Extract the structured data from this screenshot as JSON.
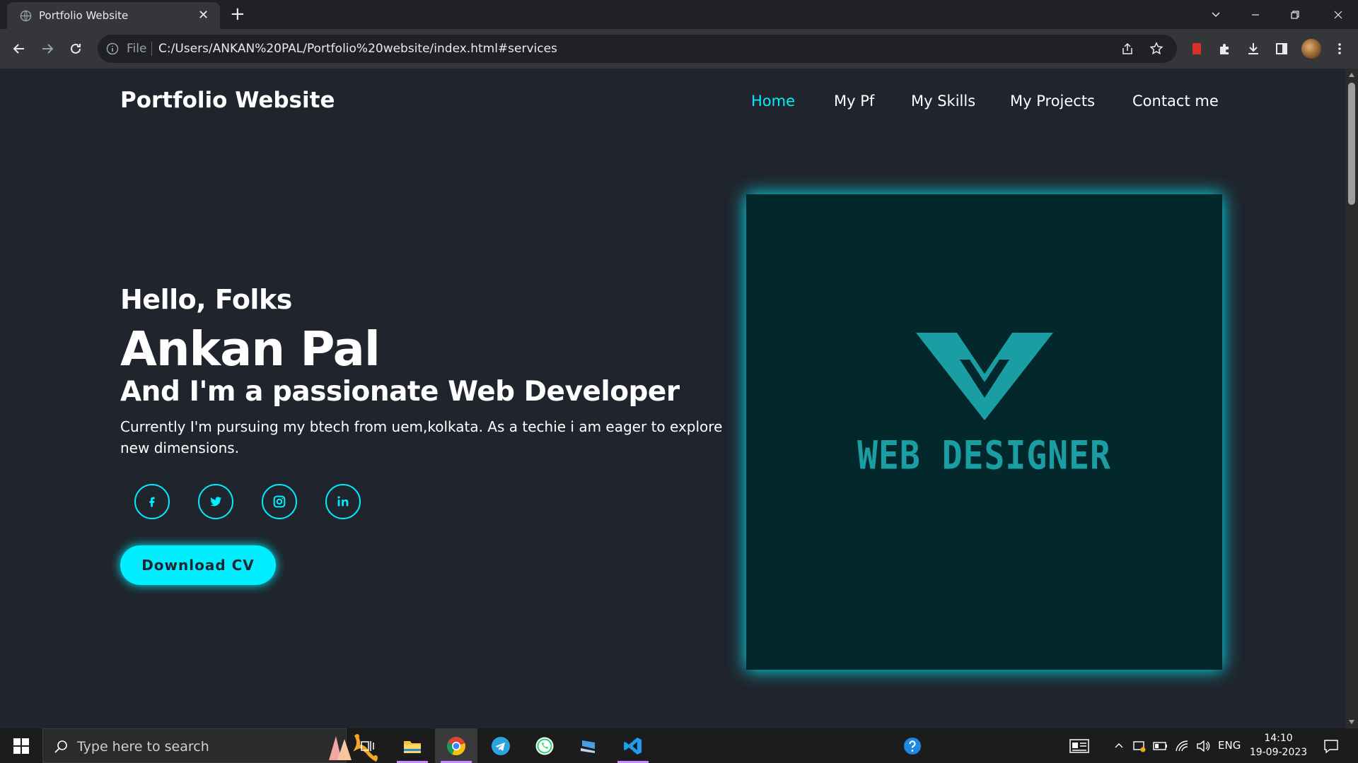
{
  "browser": {
    "tab_title": "Portfolio Website",
    "tab_close": "✕",
    "new_tab": "+",
    "address_scheme": "File",
    "address_url": "C:/Users/ANKAN%20PAL/Portfolio%20website/index.html#services",
    "icons": [
      "back-arrow-icon",
      "forward-arrow-icon",
      "reload-icon",
      "info-icon",
      "share-icon",
      "bookmark-star-icon",
      "bookmark-extension-icon",
      "extensions-puzzle-icon",
      "download-icon",
      "side-panel-icon",
      "profile-avatar",
      "kebab-menu-icon"
    ]
  },
  "site": {
    "logo": "Portfolio Website",
    "nav": [
      {
        "label": "Home",
        "active": true
      },
      {
        "label": "My Pf",
        "active": false
      },
      {
        "label": "My Skills",
        "active": false
      },
      {
        "label": "My Projects",
        "active": false
      },
      {
        "label": "Contact me",
        "active": false
      }
    ],
    "hero": {
      "greeting": "Hello, Folks",
      "name": "Ankan Pal",
      "role": "And I'm a passionate Web Developer",
      "description": "Currently I'm pursuing my btech from uem,kolkata. As a techie i am eager to explore new dimensions.",
      "socials": [
        "facebook-icon",
        "twitter-icon",
        "instagram-icon",
        "linkedin-icon"
      ],
      "cv_button": "Download CV",
      "image_caption": "WEB DESIGNER"
    },
    "colors": {
      "background": "#1f242d",
      "accent": "#00eeff",
      "image_bg": "#03282b",
      "logo_teal": "#1a9ea3"
    }
  },
  "taskbar": {
    "search_placeholder": "Type here to search",
    "language": "ENG",
    "time": "14:10",
    "date": "19-09-2023",
    "apps": [
      "task-view-icon",
      "file-explorer-icon",
      "chrome-icon",
      "telegram-icon",
      "whatsapp-icon",
      "app-icon",
      "vscode-icon"
    ]
  }
}
